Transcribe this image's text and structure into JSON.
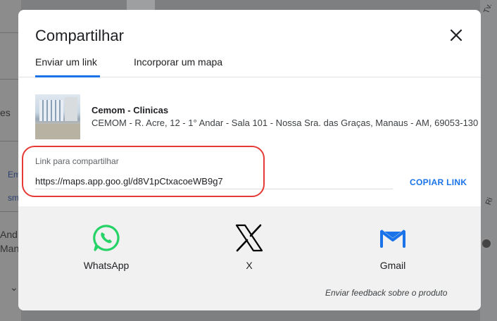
{
  "background": {
    "left_texts": [
      "es",
      "Em",
      "sm",
      "And",
      "Mana"
    ],
    "right_texts": [
      "Tv.",
      "Ri"
    ]
  },
  "dialog": {
    "title": "Compartilhar",
    "close_icon": "close-icon",
    "tabs": [
      {
        "label": "Enviar um link",
        "active": true
      },
      {
        "label": "Incorporar um mapa",
        "active": false
      }
    ],
    "place": {
      "name": "Cemom - Clinicas",
      "address": "CEMOM - R. Acre, 12 - 1° Andar - Sala 101 - Nossa Sra. das Graças, Manaus - AM, 69053-130"
    },
    "link": {
      "label": "Link para compartilhar",
      "value": "https://maps.app.goo.gl/d8V1pCtxacoeWB9g7",
      "copy_label": "COPIAR LINK"
    },
    "share_targets": [
      {
        "label": "WhatsApp",
        "icon": "whatsapp-icon",
        "color": "#25D366"
      },
      {
        "label": "X",
        "icon": "x-icon",
        "color": "#000000"
      },
      {
        "label": "Gmail",
        "icon": "gmail-icon",
        "color": "#1A73E8"
      }
    ],
    "feedback_label": "Enviar feedback sobre o produto"
  },
  "colors": {
    "accent": "#1a73e8",
    "highlight": "#e53935"
  }
}
